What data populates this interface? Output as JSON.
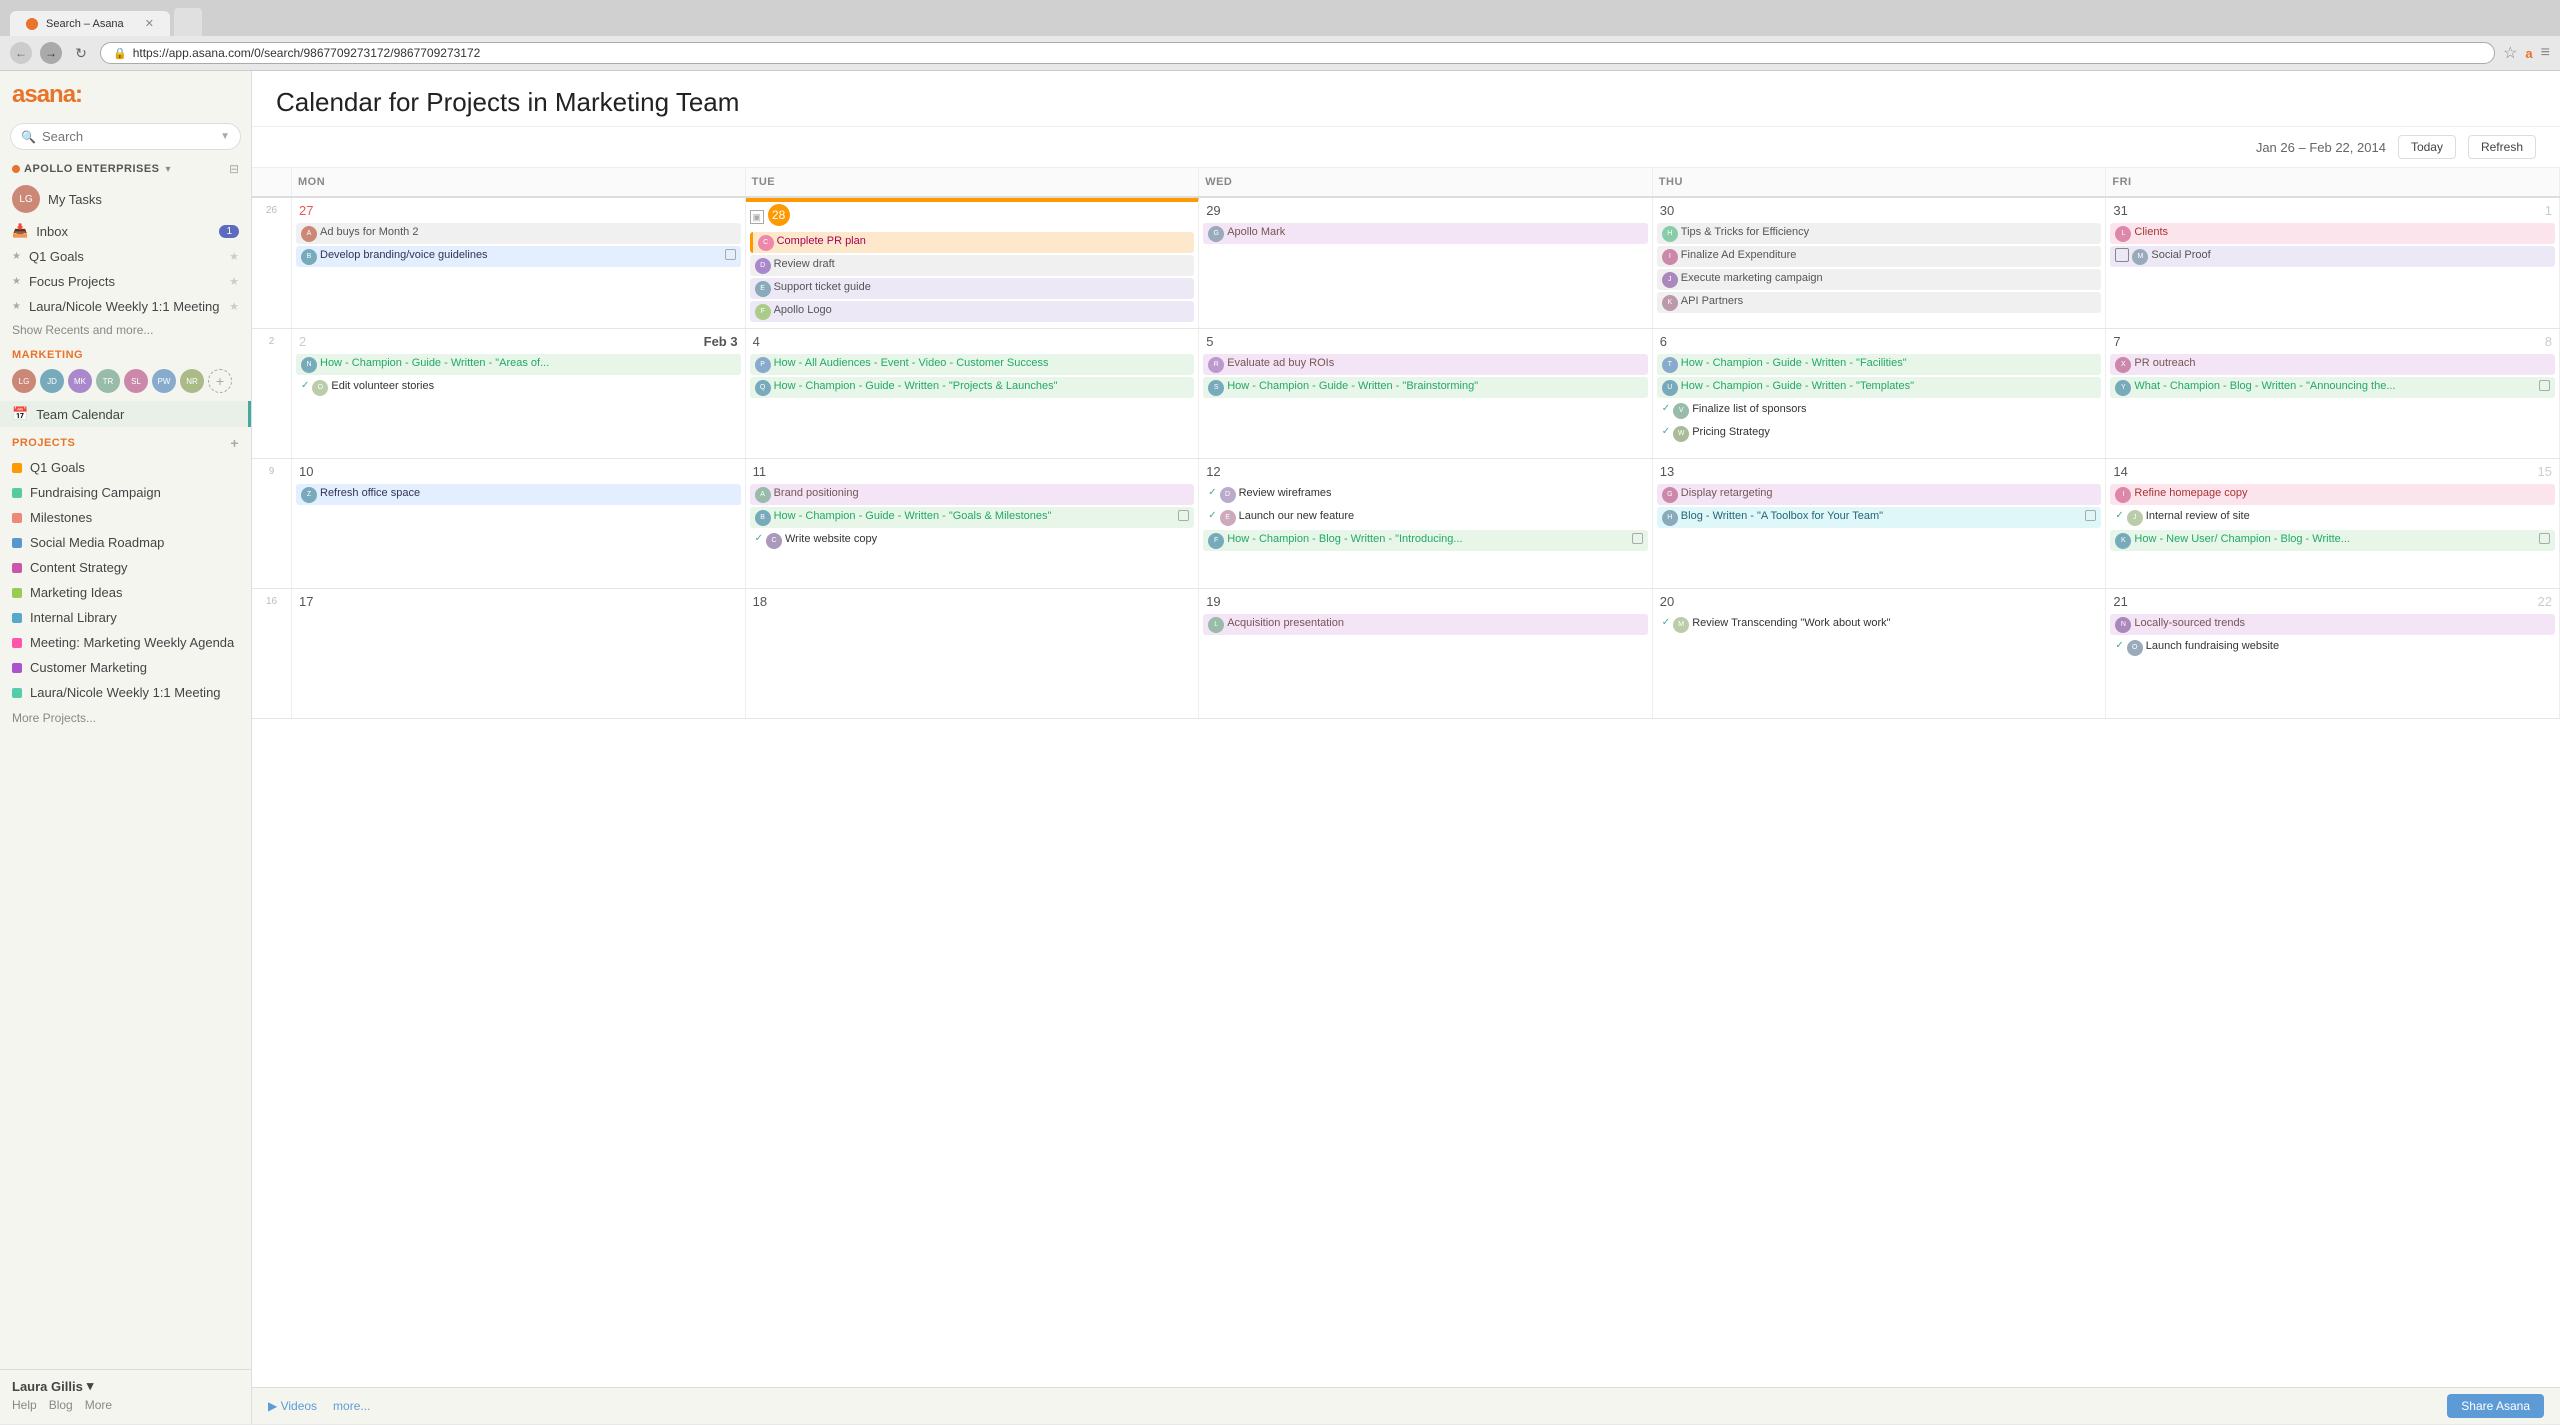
{
  "browser": {
    "tab_label": "Search – Asana",
    "url": "https://app.asana.com/0/search/9867709273172/9867709273172",
    "back_btn": "←",
    "forward_btn": "→",
    "refresh_btn": "↻"
  },
  "sidebar": {
    "logo": "asana:",
    "search_placeholder": "Search",
    "org_name": "APOLLO ENTERPRISES",
    "my_tasks": "My Tasks",
    "inbox": "Inbox",
    "inbox_badge": "1",
    "q1_goals": "Q1 Goals",
    "focus_projects": "Focus Projects",
    "weekly_meeting": "Laura/Nicole Weekly 1:1 Meeting",
    "show_recents": "Show Recents and more...",
    "marketing_label": "MARKETING",
    "team_calendar": "Team Calendar",
    "projects_label": "PROJECTS",
    "projects_add": "+",
    "projects": [
      "Q1 Goals",
      "Fundraising Campaign",
      "Milestones",
      "Social Media Roadmap",
      "Content Strategy",
      "Marketing Ideas",
      "Internal Library",
      "Meeting: Marketing Weekly Agenda",
      "Customer Marketing",
      "Laura/Nicole Weekly 1:1 Meeting"
    ],
    "more_projects": "More Projects...",
    "user_name": "Laura Gillis",
    "footer_help": "Help",
    "footer_blog": "Blog",
    "footer_more": "More"
  },
  "calendar": {
    "title": "Calendar for Projects in Marketing Team",
    "date_range": "Jan 26 – Feb 22, 2014",
    "today_btn": "Today",
    "refresh_btn": "Refresh",
    "days": [
      "MON",
      "TUE",
      "WED",
      "THU",
      "FRI"
    ],
    "weeks": [
      {
        "week_num": "26",
        "days": [
          {
            "num": "27",
            "is_weekend": true,
            "col": "MON",
            "tasks": [
              {
                "text": "Ad buys for Month 2",
                "color": "gray",
                "has_avatar": true,
                "avatar_color": "#c87"
              },
              {
                "text": "Develop branding/voice guidelines",
                "color": "blue",
                "has_avatar": true,
                "avatar_color": "#7ab",
                "has_checkbox": true
              }
            ]
          },
          {
            "num": "28",
            "today": true,
            "col": "TUE",
            "tasks": [
              {
                "text": "Complete PR plan",
                "color": "orange",
                "has_avatar": true,
                "avatar_color": "#e8a"
              },
              {
                "text": "Review draft",
                "color": "gray",
                "has_avatar": true,
                "avatar_color": "#a8c"
              },
              {
                "text": "Support ticket guide",
                "color": "purple",
                "has_avatar": true,
                "avatar_color": "#8ab"
              },
              {
                "text": "Apollo Logo",
                "color": "purple",
                "has_avatar": true,
                "avatar_color": "#ac8"
              }
            ]
          },
          {
            "num": "29",
            "col": "WED",
            "tasks": [
              {
                "text": "Apollo Mark",
                "color": "lavender",
                "has_avatar": true,
                "avatar_color": "#9ab"
              }
            ]
          },
          {
            "num": "30",
            "col": "THU",
            "tasks": [
              {
                "text": "Tips & Tricks for Efficiency",
                "color": "gray",
                "has_avatar": true,
                "avatar_color": "#8ca"
              },
              {
                "text": "Finalize Ad Expenditure",
                "color": "gray",
                "has_avatar": true,
                "avatar_color": "#c8a"
              },
              {
                "text": "Execute marketing campaign",
                "color": "gray",
                "has_avatar": true,
                "avatar_color": "#a8b"
              },
              {
                "text": "API Partners",
                "color": "gray",
                "has_avatar": true,
                "avatar_color": "#b9a"
              }
            ]
          },
          {
            "num": "31",
            "col": "FRI",
            "tasks": [
              {
                "text": "Clients",
                "color": "pink",
                "has_avatar": true,
                "avatar_color": "#d8a"
              },
              {
                "text": "Social Proof",
                "color": "purple",
                "has_avatar": true,
                "avatar_color": "#9ab",
                "has_checkbox": true
              }
            ]
          }
        ]
      },
      {
        "week_num": "2",
        "days": [
          {
            "num": "Feb 3",
            "multi": true,
            "start_num": "2",
            "col": "MON",
            "tasks": [
              {
                "text": "How - Champion - Guide - Written - \"Areas of...",
                "color": "green",
                "has_avatar": true,
                "avatar_color": "#7ab"
              },
              {
                "text": "Edit volunteer stories",
                "color": "none",
                "has_check": true,
                "has_avatar": true,
                "avatar_color": "#bca"
              }
            ]
          },
          {
            "num": "4",
            "col": "TUE",
            "tasks": [
              {
                "text": "How - All Audiences - Event - Video - Customer Success",
                "color": "green",
                "has_avatar": true,
                "avatar_color": "#8ac"
              },
              {
                "text": "How - Champion - Guide - Written - \"Projects & Launches\"",
                "color": "green",
                "has_avatar": true,
                "avatar_color": "#7ab"
              }
            ]
          },
          {
            "num": "5",
            "col": "WED",
            "tasks": [
              {
                "text": "Evaluate ad buy ROIs",
                "color": "lavender",
                "has_avatar": true,
                "avatar_color": "#b9c"
              },
              {
                "text": "How - Champion - Guide - Written - \"Brainstorming\"",
                "color": "green",
                "has_avatar": true,
                "avatar_color": "#7ab"
              }
            ]
          },
          {
            "num": "6",
            "col": "THU",
            "tasks": [
              {
                "text": "How - Champion - Guide - Written - \"Facilities\"",
                "color": "green",
                "has_avatar": true,
                "avatar_color": "#8ac"
              },
              {
                "text": "How - Champion - Guide - Written - \"Templates\"",
                "color": "green",
                "has_avatar": true,
                "avatar_color": "#7ab"
              },
              {
                "text": "Finalize list of sponsors",
                "color": "none",
                "has_check": true,
                "has_avatar": true,
                "avatar_color": "#9ba"
              },
              {
                "text": "Pricing Strategy",
                "color": "none",
                "has_check": true,
                "has_avatar": true,
                "avatar_color": "#ab9"
              }
            ]
          },
          {
            "num": "7",
            "col": "FRI",
            "tasks": [
              {
                "text": "PR outreach",
                "color": "lavender",
                "has_avatar": true,
                "avatar_color": "#c8a"
              },
              {
                "text": "What - Champion - Blog - Written - \"Announcing the...",
                "color": "green",
                "has_avatar": true,
                "avatar_color": "#7ab",
                "has_checkbox": true
              }
            ]
          }
        ]
      },
      {
        "week_num": "9",
        "days": [
          {
            "num": "10",
            "col": "MON",
            "tasks": [
              {
                "text": "Refresh office space",
                "color": "blue",
                "has_avatar": true,
                "avatar_color": "#7ab"
              }
            ]
          },
          {
            "num": "11",
            "col": "TUE",
            "tasks": [
              {
                "text": "Brand positioning",
                "color": "lavender",
                "has_avatar": true,
                "avatar_color": "#9ba"
              },
              {
                "text": "How - Champion - Guide - Written - \"Goals & Milestones\"",
                "color": "green",
                "has_avatar": true,
                "avatar_color": "#7ab",
                "has_checkbox": true
              },
              {
                "text": "Write website copy",
                "color": "none",
                "has_check": true,
                "has_avatar": true,
                "avatar_color": "#a9b"
              }
            ]
          },
          {
            "num": "12",
            "col": "WED",
            "tasks": [
              {
                "text": "Review wireframes",
                "color": "none",
                "has_check": true,
                "has_avatar": true,
                "avatar_color": "#bac"
              },
              {
                "text": "Launch our new feature",
                "color": "none",
                "has_check": true,
                "has_avatar": true,
                "avatar_color": "#cab"
              },
              {
                "text": "How - Champion - Blog - Written - \"Introducing...",
                "color": "green",
                "has_avatar": true,
                "avatar_color": "#7ab",
                "has_checkbox": true
              }
            ]
          },
          {
            "num": "13",
            "col": "THU",
            "tasks": [
              {
                "text": "Display retargeting",
                "color": "lavender",
                "has_avatar": true,
                "avatar_color": "#c8a"
              },
              {
                "text": "Blog - Written - \"A Toolbox for Your Team\"",
                "color": "teal",
                "has_avatar": true,
                "avatar_color": "#8ab",
                "has_checkbox": true
              }
            ]
          },
          {
            "num": "14",
            "col": "FRI",
            "tasks": [
              {
                "text": "Refine homepage copy",
                "color": "pink",
                "has_avatar": true,
                "avatar_color": "#d8a"
              },
              {
                "text": "Internal review of site",
                "color": "none",
                "has_check": true,
                "has_avatar": true,
                "avatar_color": "#bca"
              },
              {
                "text": "How - New User/ Champion - Blog - Writte...",
                "color": "green",
                "has_avatar": true,
                "avatar_color": "#7ab",
                "has_checkbox": true
              }
            ]
          }
        ]
      },
      {
        "week_num": "16",
        "days": [
          {
            "num": "17",
            "col": "MON",
            "tasks": []
          },
          {
            "num": "18",
            "col": "TUE",
            "tasks": []
          },
          {
            "num": "19",
            "col": "WED",
            "tasks": [
              {
                "text": "Acquisition presentation",
                "color": "lavender",
                "has_avatar": true,
                "avatar_color": "#9ba"
              }
            ]
          },
          {
            "num": "20",
            "col": "THU",
            "tasks": [
              {
                "text": "Review Transcending \"Work about work\"",
                "color": "none",
                "has_check": true,
                "has_avatar": true,
                "avatar_color": "#bca"
              }
            ]
          },
          {
            "num": "21",
            "col": "FRI",
            "tasks": [
              {
                "text": "Locally-sourced trends",
                "color": "lavender",
                "has_avatar": true,
                "avatar_color": "#a8b"
              },
              {
                "text": "Launch fundraising website",
                "color": "none",
                "has_check": true,
                "has_avatar": true,
                "avatar_color": "#9ab"
              }
            ]
          }
        ]
      }
    ],
    "footer_videos": "▶ Videos",
    "footer_more": "more...",
    "share_btn": "Share Asana"
  },
  "colors": {
    "orange": "#f90",
    "brand": "#e8732a",
    "accent_blue": "#5c9bd6",
    "green_check": "#4a9"
  }
}
